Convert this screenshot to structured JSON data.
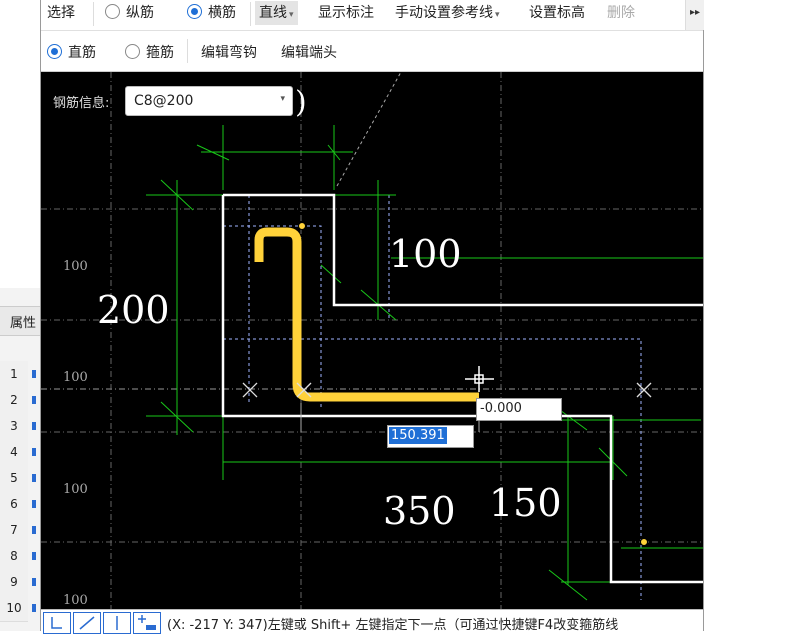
{
  "toolbar": {
    "select": "选择",
    "longitudinal": "纵筋",
    "transverse": "横筋",
    "line": "直线",
    "show_annotation": "显示标注",
    "manual_guide": "手动设置参考线",
    "set_elevation": "设置标高",
    "delete": "删除"
  },
  "toolbar2": {
    "straight_bar": "直筋",
    "stirrup": "箍筋",
    "edit_hook": "编辑弯钩",
    "edit_end": "编辑端头"
  },
  "rebar_info": {
    "label": "钢筋信息:",
    "value": "C8@200"
  },
  "paren": ")",
  "dimensions": {
    "d100_right": "100",
    "d200_left": "200",
    "d350": "350",
    "d150": "150",
    "axis_100_a": "100",
    "axis_100_b": "100",
    "axis_100_c": "100",
    "axis_100_d": "100"
  },
  "inputs": {
    "angle": "-0.000",
    "length": "150.391"
  },
  "status_text": "(X: -217 Y: 347)左键或 Shift+ 左键指定下一点（可通过快捷键F4改变箍筋线",
  "properties": {
    "tab": "属性",
    "rows": [
      "1",
      "2",
      "3",
      "4",
      "5",
      "6",
      "7",
      "8",
      "9",
      "10"
    ]
  },
  "colors": {
    "canvas": "#000000",
    "rebar": "#ffd23a",
    "dim_line": "#19c719",
    "outline": "#ffffff",
    "accent": "#1f6fd6"
  }
}
